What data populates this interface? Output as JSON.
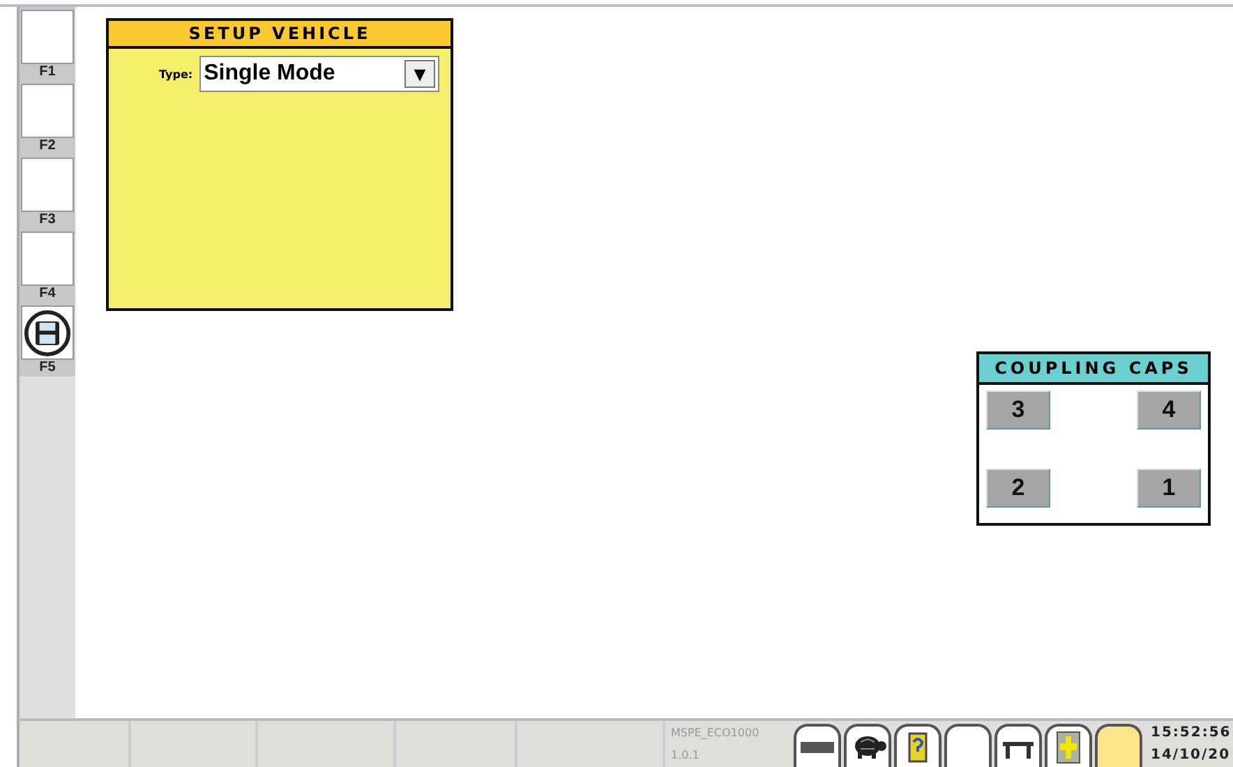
{
  "function_keys": [
    {
      "label": "F1",
      "kind": "blank"
    },
    {
      "label": "F2",
      "kind": "blank"
    },
    {
      "label": "F3",
      "kind": "blank"
    },
    {
      "label": "F4",
      "kind": "blank"
    },
    {
      "label": "F5",
      "kind": "save"
    }
  ],
  "setup_vehicle": {
    "title": "SETUP VEHICLE",
    "type_label": "Type:",
    "type_value": "Single Mode",
    "dropdown_arrow": "▼"
  },
  "coupling_caps": {
    "title": "COUPLING CAPS",
    "buttons": [
      "3",
      "4",
      "2",
      "1"
    ]
  },
  "status_bar": {
    "app_name": "MSPE_ECO1000",
    "version": "1.0.1",
    "tool_buttons": [
      {
        "kind": "bar"
      },
      {
        "kind": "turtle"
      },
      {
        "kind": "question-card"
      },
      {
        "kind": "blank"
      },
      {
        "kind": "lift"
      },
      {
        "kind": "vehicle-card"
      },
      {
        "kind": "indicator"
      }
    ],
    "time": "15:52:56",
    "date": "14/10/20"
  }
}
